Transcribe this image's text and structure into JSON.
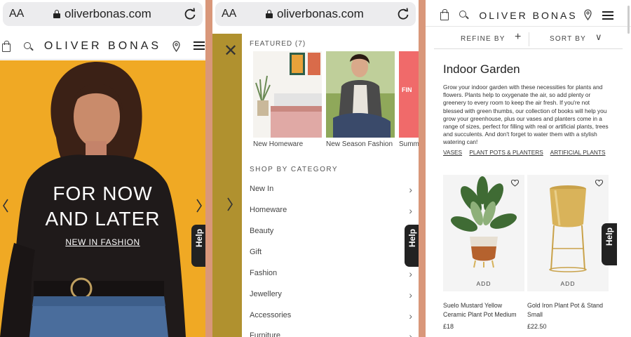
{
  "browser": {
    "text_size_label": "AA",
    "url": "oliverbonas.com"
  },
  "site": {
    "logo": "OLIVER BONAS",
    "help_label": "Help"
  },
  "hero": {
    "headline_line1": "FOR NOW",
    "headline_line2": "AND LATER",
    "link": "NEW IN FASHION"
  },
  "menu": {
    "featured_label": "FEATURED (7)",
    "featured": [
      "New Homeware",
      "New Season Fashion",
      "Summ"
    ],
    "category_heading": "SHOP BY CATEGORY",
    "categories": [
      "New In",
      "Homeware",
      "Beauty",
      "Gift",
      "Fashion",
      "Jewellery",
      "Accessories",
      "Furniture"
    ]
  },
  "listing": {
    "refine_label": "REFINE BY",
    "sort_label": "SORT BY",
    "title": "Indoor Garden",
    "description": "Grow your indoor garden with these necessities for plants and flowers. Plants help to oxygenate the air, so add plenty or greenery to every room to keep the air fresh. If you're not blessed with green thumbs, our collection of books will help you grow your greenhouse, plus our vases and planters come in a range of sizes, perfect for filling with real or artificial plants, trees and succulents. And don't forget to water them with a stylish watering can!",
    "links": [
      "VASES",
      "PLANT POTS & PLANTERS",
      "ARTIFICIAL PLANTS"
    ],
    "add_label": "ADD",
    "products": [
      {
        "name": "Suelo Mustard Yellow Ceramic Plant Pot Medium",
        "price": "£18"
      },
      {
        "name": "Gold Iron Plant Pot & Stand Small",
        "price": "£22.50"
      }
    ]
  },
  "colors": {
    "hero_bg": "#f0a924",
    "menu_strip": "#b0912f",
    "divider": "#d9977a"
  }
}
